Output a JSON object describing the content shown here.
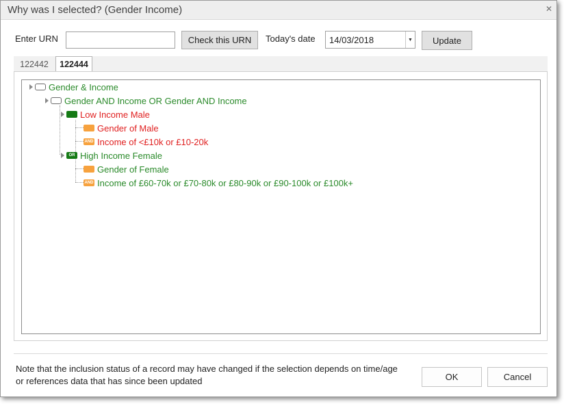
{
  "window": {
    "title": "Why was I selected? (Gender  Income)"
  },
  "form": {
    "urn_label": "Enter URN",
    "urn_value": "",
    "check_label": "Check this URN",
    "date_label": "Today's date",
    "date_value": "14/03/2018",
    "update_label": "Update"
  },
  "tabs": [
    {
      "label": "122442",
      "active": false
    },
    {
      "label": "122444",
      "active": true
    }
  ],
  "tree": {
    "root": "Gender & Income",
    "group": "Gender AND Income OR Gender AND Income",
    "low_income": "Low Income Male",
    "gender_male": "Gender of Male",
    "income_low": "Income of <£10k or £10-20k",
    "high_income": "High Income Female",
    "gender_female": "Gender of Female",
    "income_high": "Income of £60-70k or £70-80k or £80-90k or £90-100k or £100k+",
    "badge_and": "AND",
    "badge_or": "OR"
  },
  "note": "Note that the inclusion status of a record may have changed if the selection depends on time/age or references data that has since been updated",
  "buttons": {
    "ok": "OK",
    "cancel": "Cancel"
  },
  "icons": {
    "close": "close-icon",
    "dropdown": "dropdown-arrow-icon"
  },
  "colors": {
    "green": "#2a8a2a",
    "red": "#e02020",
    "badge_green": "#157a15",
    "badge_orange": "#f7a23e"
  }
}
